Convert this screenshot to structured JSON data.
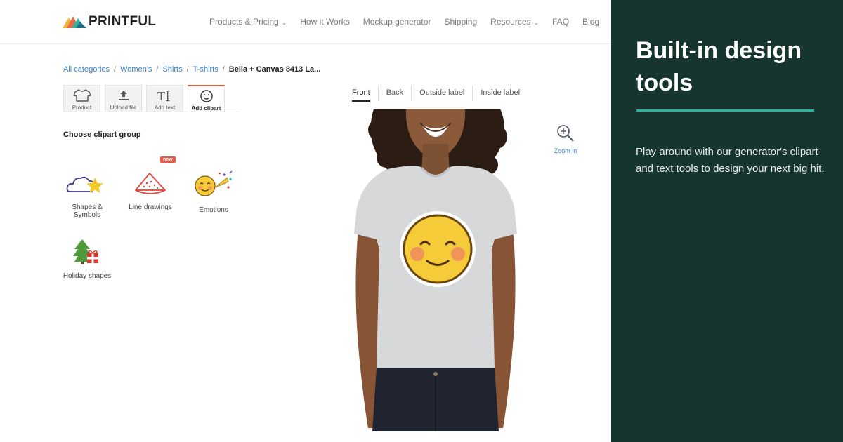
{
  "brand": {
    "name": "PRINTFUL"
  },
  "nav": {
    "products_pricing": "Products & Pricing",
    "how_it_works": "How it Works",
    "mockup_generator": "Mockup generator",
    "shipping": "Shipping",
    "resources": "Resources",
    "faq": "FAQ",
    "blog": "Blog"
  },
  "breadcrumb": {
    "items": [
      "All categories",
      "Women's",
      "Shirts",
      "T-shirts"
    ],
    "current": "Bella + Canvas 8413 La...",
    "separator": "/"
  },
  "tools": {
    "product": "Product",
    "upload": "Upload file",
    "text": "Add text",
    "clipart": "Add clipart"
  },
  "clipart": {
    "heading": "Choose clipart group",
    "badge": "new",
    "groups": [
      {
        "label": "Shapes & Symbols",
        "icon": "cloud-star-icon"
      },
      {
        "label": "Line drawings",
        "icon": "watermelon-icon"
      },
      {
        "label": "Emotions",
        "icon": "smiley-party-icon"
      },
      {
        "label": "Holiday shapes",
        "icon": "tree-gift-icon"
      }
    ]
  },
  "views": {
    "front": "Front",
    "back": "Back",
    "outside": "Outside label",
    "inside": "Inside label"
  },
  "zoom": {
    "label": "Zoom in"
  },
  "panel": {
    "title": "Built-in design tools",
    "body": "Play around with our generator's clipart and text tools to design your next big hit."
  },
  "colors": {
    "panel_bg": "#17352f",
    "panel_accent": "#2bb5a0",
    "link": "#3b7fc4",
    "active_tab": "#e05a47",
    "shirt": "#d6d8d9"
  }
}
